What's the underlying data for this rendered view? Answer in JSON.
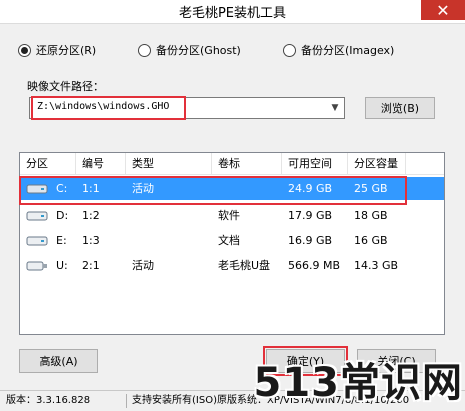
{
  "window": {
    "title": "老毛桃PE装机工具",
    "close_glyph": "✕"
  },
  "modes": [
    {
      "label": "还原分区(R)",
      "selected": true
    },
    {
      "label": "备份分区(Ghost)",
      "selected": false
    },
    {
      "label": "备份分区(Imagex)",
      "selected": false
    }
  ],
  "image_path": {
    "label": "映像文件路径：",
    "value": "Z:\\windows\\windows.GHO",
    "browse_label": "浏览(B)"
  },
  "partition_table": {
    "columns": [
      "分区",
      "编号",
      "类型",
      "卷标",
      "可用空间",
      "分区容量"
    ],
    "rows": [
      {
        "drive": "C:",
        "number": "1:1",
        "type": "活动",
        "label": "",
        "free": "24.9 GB",
        "size": "25 GB",
        "selected": true,
        "icon": "disk-icon"
      },
      {
        "drive": "D:",
        "number": "1:2",
        "type": "",
        "label": "软件",
        "free": "17.9 GB",
        "size": "18 GB",
        "selected": false,
        "icon": "disk-icon"
      },
      {
        "drive": "E:",
        "number": "1:3",
        "type": "",
        "label": "文档",
        "free": "16.9 GB",
        "size": "16 GB",
        "selected": false,
        "icon": "disk-icon"
      },
      {
        "drive": "U:",
        "number": "2:1",
        "type": "活动",
        "label": "老毛桃U盘",
        "free": "566.9 MB",
        "size": "14.3 GB",
        "selected": false,
        "icon": "usb-disk-icon"
      }
    ]
  },
  "buttons": {
    "advanced": "高级(A)",
    "ok": "确定(Y)",
    "close": "关闭(C)"
  },
  "status": {
    "version": "版本：3.3.16.828",
    "support": "支持安装所有(ISO)原版系统：XP/VISTA/WIN7/8/8.1/10/200"
  },
  "watermark": "513常识网",
  "colors": {
    "selection": "#3399ff",
    "highlight_box": "#e2303a",
    "close_button": "#c8342a"
  }
}
